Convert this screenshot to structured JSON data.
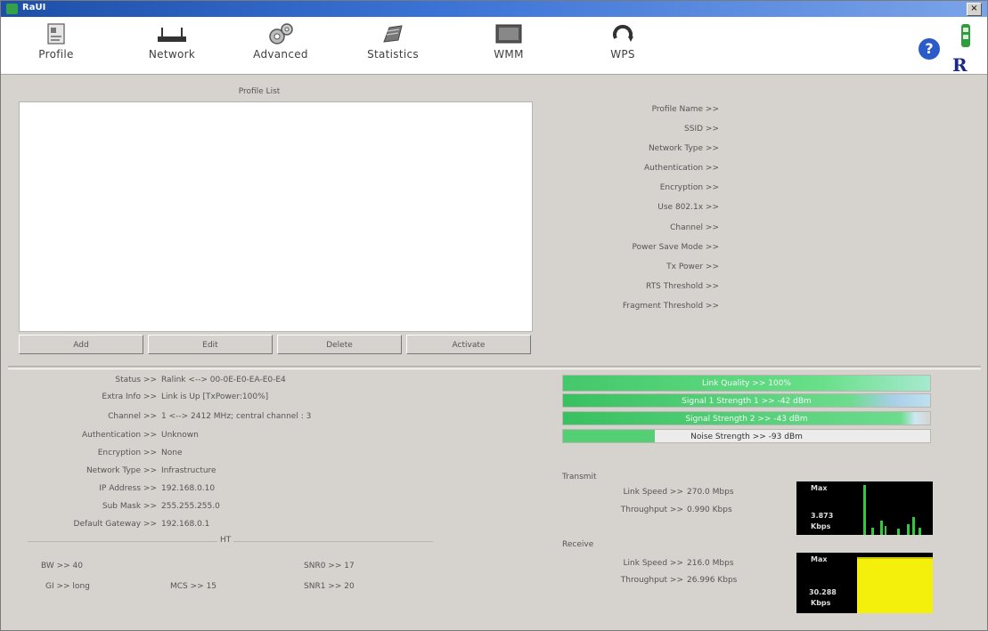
{
  "window": {
    "title": "RaUI"
  },
  "toolbar": {
    "items": [
      {
        "label": "Profile",
        "icon": "profile-icon"
      },
      {
        "label": "Network",
        "icon": "network-icon"
      },
      {
        "label": "Advanced",
        "icon": "gears-icon"
      },
      {
        "label": "Statistics",
        "icon": "statistics-icon"
      },
      {
        "label": "WMM",
        "icon": "wmm-icon"
      },
      {
        "label": "WPS",
        "icon": "wps-icon"
      }
    ],
    "help_glyph": "?"
  },
  "profile": {
    "list_title": "Profile List",
    "buttons": {
      "add": "Add",
      "edit": "Edit",
      "delete": "Delete",
      "activate": "Activate"
    },
    "details": [
      "Profile Name >>",
      "SSID >>",
      "Network Type >>",
      "Authentication >>",
      "Encryption >>",
      "Use 802.1x >>",
      "Channel >>",
      "Power Save Mode >>",
      "Tx Power >>",
      "RTS Threshold >>",
      "Fragment Threshold >>"
    ]
  },
  "status": {
    "rows": [
      {
        "label": "Status >>",
        "value": "Ralink <--> 00-0E-E0-EA-E0-E4"
      },
      {
        "label": "Extra Info >>",
        "value": "Link is Up [TxPower:100%]"
      },
      {
        "label": "Channel >>",
        "value": "1 <--> 2412 MHz; central channel : 3"
      },
      {
        "label": "Authentication >>",
        "value": "Unknown"
      },
      {
        "label": "Encryption >>",
        "value": "None"
      },
      {
        "label": "Network Type >>",
        "value": "Infrastructure"
      },
      {
        "label": "IP Address >>",
        "value": "192.168.0.10"
      },
      {
        "label": "Sub Mask >>",
        "value": "255.255.255.0"
      },
      {
        "label": "Default Gateway >>",
        "value": "192.168.0.1"
      }
    ]
  },
  "ht": {
    "title": "HT",
    "bw": "BW >> 40",
    "gi": "GI >> long",
    "mcs": "MCS >> 15",
    "snr0": "SNR0 >> 17",
    "snr1": "SNR1 >> 20"
  },
  "signal": {
    "link_quality": "Link Quality >> 100%",
    "signal1": "Signal 1 Strength 1 >> -42 dBm",
    "signal2": "Signal Strength 2 >> -43 dBm",
    "noise": "Noise Strength >> -93 dBm"
  },
  "transmit": {
    "title": "Transmit",
    "link_speed_label": "Link Speed >>",
    "link_speed_value": "270.0 Mbps",
    "throughput_label": "Throughput >>",
    "throughput_value": "0.990 Kbps",
    "graph_max": "Max",
    "graph_value": "3.873",
    "graph_unit": "Kbps"
  },
  "receive": {
    "title": "Receive",
    "link_speed_label": "Link Speed >>",
    "link_speed_value": "216.0 Mbps",
    "throughput_label": "Throughput >>",
    "throughput_value": "26.996 Kbps",
    "graph_max": "Max",
    "graph_value": "30.288",
    "graph_unit": "Kbps"
  },
  "colors": {
    "title_bar": "#1d4fa8",
    "signal_green": "#43c86b",
    "graph_tx": "#2fcb3b",
    "graph_rx": "#f4f00c",
    "graph_bg": "#000000"
  }
}
